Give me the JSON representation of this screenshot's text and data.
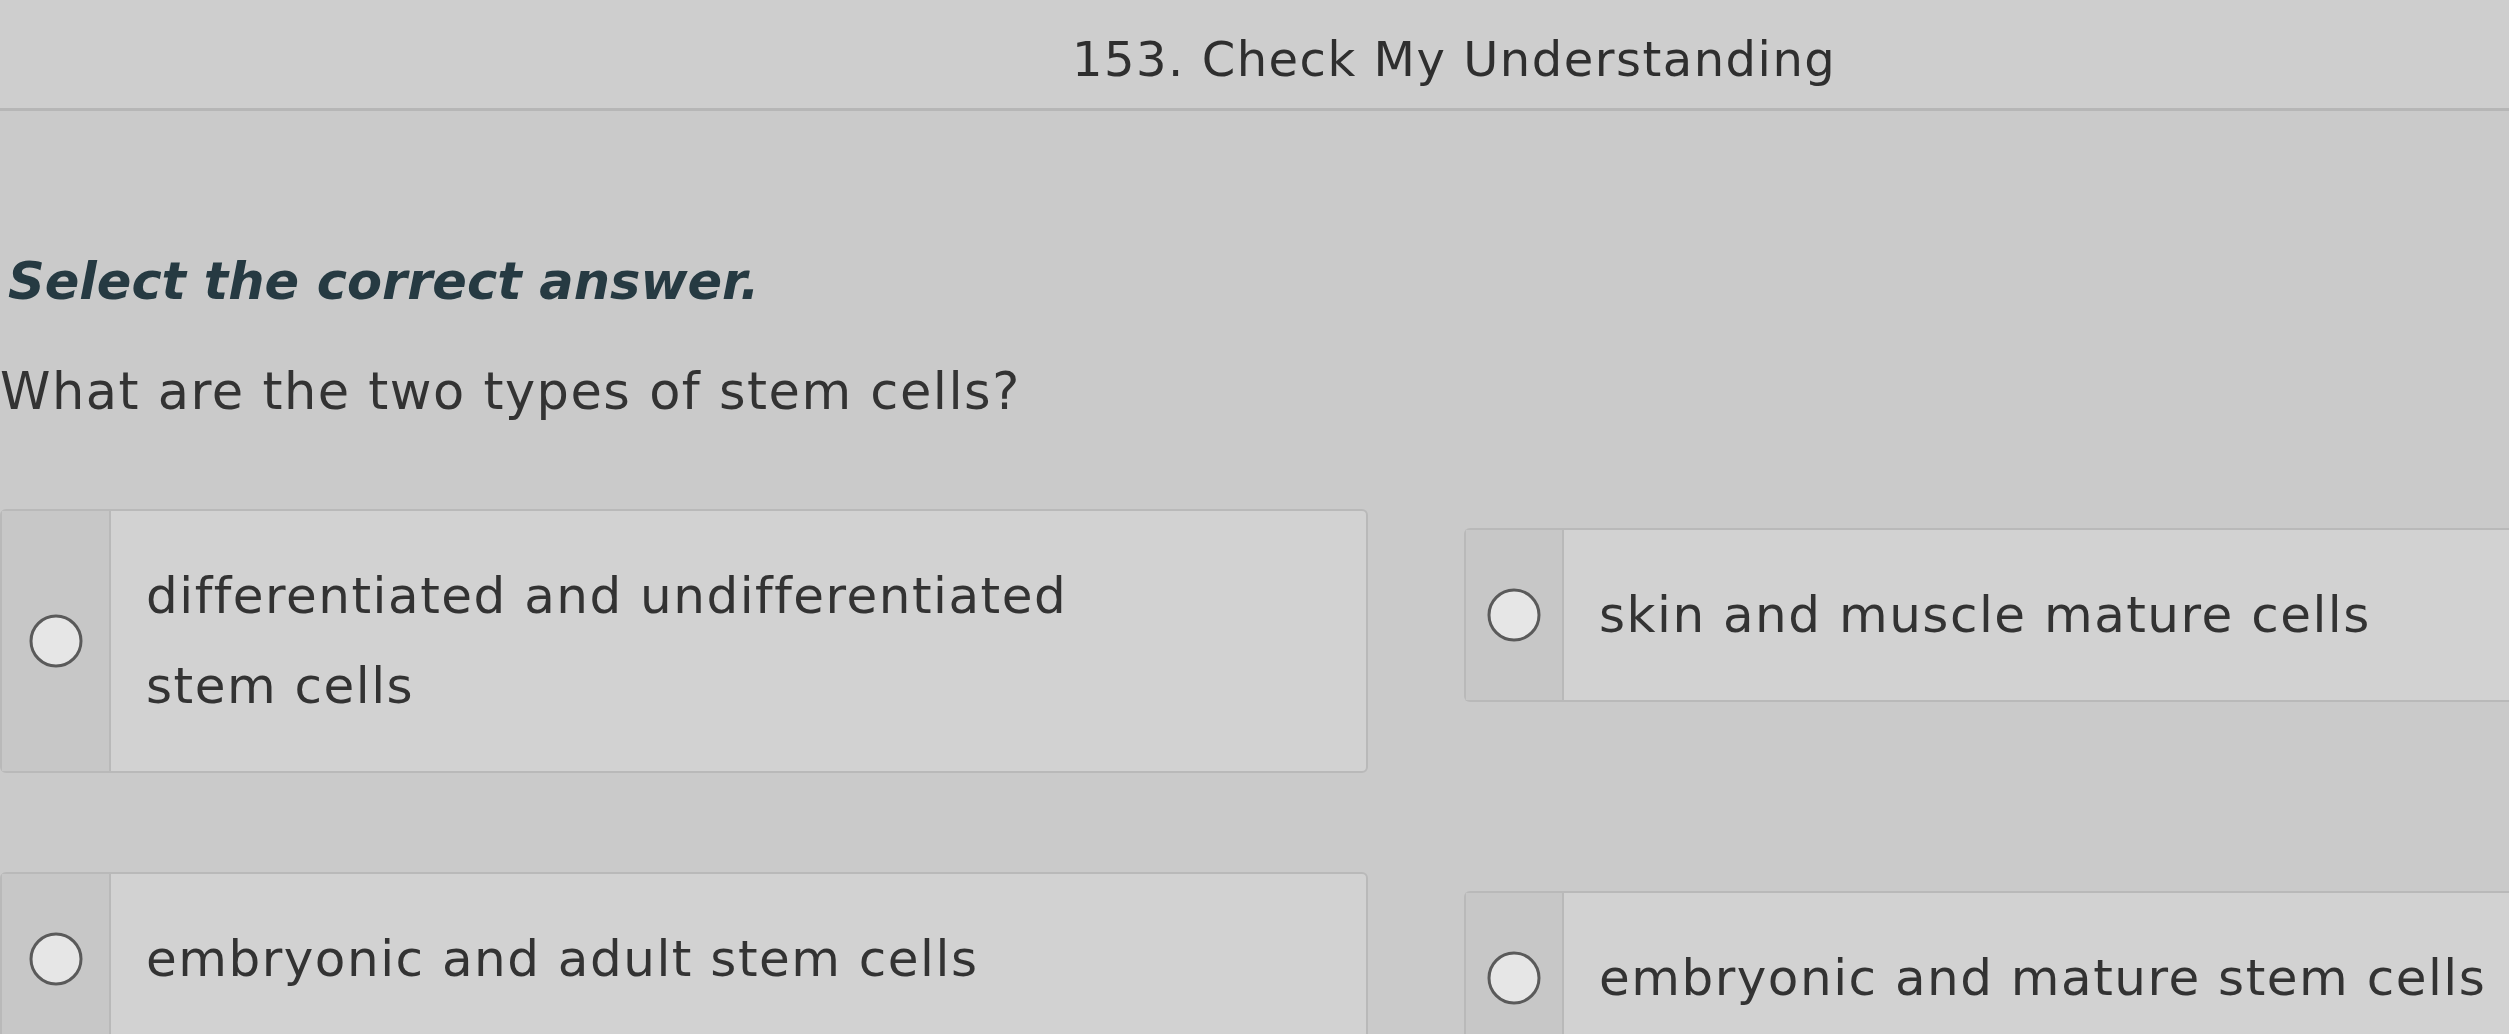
{
  "header": {
    "title": "153. Check My Understanding"
  },
  "instruction": "Select the correct answer.",
  "question": "What are the two types of stem cells?",
  "options": [
    {
      "label": "differentiated and undifferentiated stem cells",
      "selected": false
    },
    {
      "label": "skin and muscle mature cells",
      "selected": false
    },
    {
      "label": "embryonic and adult stem cells",
      "selected": false
    },
    {
      "label": "embryonic and mature stem cells",
      "selected": false
    }
  ]
}
